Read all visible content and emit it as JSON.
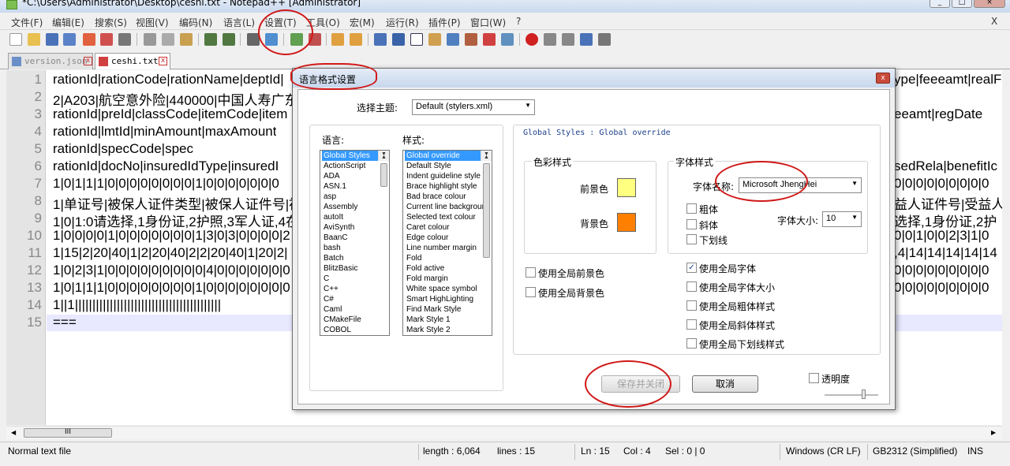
{
  "window": {
    "title": "*C:\\Users\\Administrator\\Desktop\\ceshi.txt - Notepad++ [Administrator]",
    "close_label": "X"
  },
  "menu": [
    "文件(F)",
    "编辑(E)",
    "搜索(S)",
    "视图(V)",
    "编码(N)",
    "语言(L)",
    "设置(T)",
    "工具(O)",
    "宏(M)",
    "运行(R)",
    "插件(P)",
    "窗口(W)",
    "?"
  ],
  "tabs": [
    {
      "label": "version.json",
      "active": false
    },
    {
      "label": "ceshi.txt",
      "active": true
    }
  ],
  "editor": {
    "line_numbers": [
      "1",
      "2",
      "3",
      "4",
      "5",
      "6",
      "7",
      "8",
      "9",
      "10",
      "11",
      "12",
      "13",
      "14",
      "15"
    ],
    "lines": [
      "rationId|rationCode|rationName|deptId|",
      "2|A203|航空意外险|440000|中国人寿广东",
      "rationId|preId|classCode|itemCode|item",
      "rationId|lmtId|minAmount|maxAmount",
      "rationId|specCode|spec",
      "rationId|docNo|insuredIdType|insuredI",
      "1|0|1|1|1|0|0|0|0|0|0|0|0|1|0|0|0|0|0|0|0",
      "1|单证号|被保人证件类型|被保人证件号|被",
      "1|0|1:0请选择,1身份证,2护照,3军人证,4在",
      "1|0|0|0|0|1|0|0|0|0|0|0|0|1|3|0|3|0|0|0|0|2",
      "1|15|2|20|40|1|2|20|40|2|2|20|40|1|20|2|",
      "1|0|2|3|1|0|0|0|0|0|0|0|0|0|4|0|0|0|0|0|0|0",
      "1|0|1|1|1|0|0|0|0|0|0|0|0|1|0|0|0|0|0|0|0|0",
      "1||1||||||||||||||||||||||||||||||||||||||||||",
      "==="
    ],
    "right_lines": [
      "ype|feeeamt|realF",
      "",
      "eeamt|regDate",
      "",
      "",
      "sedRela|benefitIc",
      "0|0|0|0|0|0|0|0|0",
      "益人证件号|受益人",
      "选择,1身份证,2护",
      "0|0|1|0|0|2|3|1|0",
      ",4|14|14|14|14|14",
      "0|0|0|0|0|0|0|0|0",
      "0|0|0|0|0|0|0|0|0",
      "",
      ""
    ]
  },
  "hscroll_thumb": "III",
  "statusbar": {
    "file_type": "Normal text file",
    "length": "length : 6,064",
    "lines": "lines : 15",
    "ln": "Ln : 15",
    "col": "Col : 4",
    "sel": "Sel : 0 | 0",
    "eol": "Windows (CR LF)",
    "encoding": "GB2312 (Simplified)",
    "mode": "INS"
  },
  "dialog": {
    "title": "语言格式设置",
    "close_label": "x",
    "theme_label": "选择主题:",
    "theme_value": "Default (stylers.xml)",
    "language_label": "语言:",
    "style_label": "样式:",
    "languages": [
      "Global Styles",
      "ActionScript",
      "ADA",
      "ASN.1",
      "asp",
      "Assembly",
      "autoIt",
      "AviSynth",
      "BaanC",
      "bash",
      "Batch",
      "BlitzBasic",
      "C",
      "C++",
      "C#",
      "Caml",
      "CMakeFile",
      "COBOL"
    ],
    "styles": [
      "Global override",
      "Default Style",
      "Indent guideline style",
      "Brace highlight style",
      "Bad brace colour",
      "Current line background",
      "Selected text colour",
      "Caret colour",
      "Edge colour",
      "Line number margin",
      "Fold",
      "Fold active",
      "Fold margin",
      "White space symbol",
      "Smart HighLighting",
      "Find Mark Style",
      "Mark Style 1",
      "Mark Style 2"
    ],
    "heading": "Global Styles : Global override",
    "color_group": "色彩样式",
    "fg_label": "前景色",
    "bg_label": "背景色",
    "fg_color": "#ffff80",
    "bg_color": "#ff8000",
    "font_group": "字体样式",
    "font_name_label": "字体名称:",
    "font_name_value": "Microsoft JhengHei",
    "bold_label": "粗体",
    "italic_label": "斜体",
    "underline_label": "下划线",
    "font_size_label": "字体大小:",
    "font_size_value": "10",
    "use_global_fg": "使用全局前景色",
    "use_global_bg": "使用全局背景色",
    "use_global_font": "使用全局字体",
    "use_global_font_size": "使用全局字体大小",
    "use_global_bold": "使用全局粗体样式",
    "use_global_italic": "使用全局斜体样式",
    "use_global_underline": "使用全局下划线样式",
    "save_close": "保存并关闭",
    "cancel": "取消",
    "transparency": "透明度",
    "check_mark": "✓"
  },
  "colors": {
    "selection": "#3399ff",
    "annotation": "#d01818"
  }
}
